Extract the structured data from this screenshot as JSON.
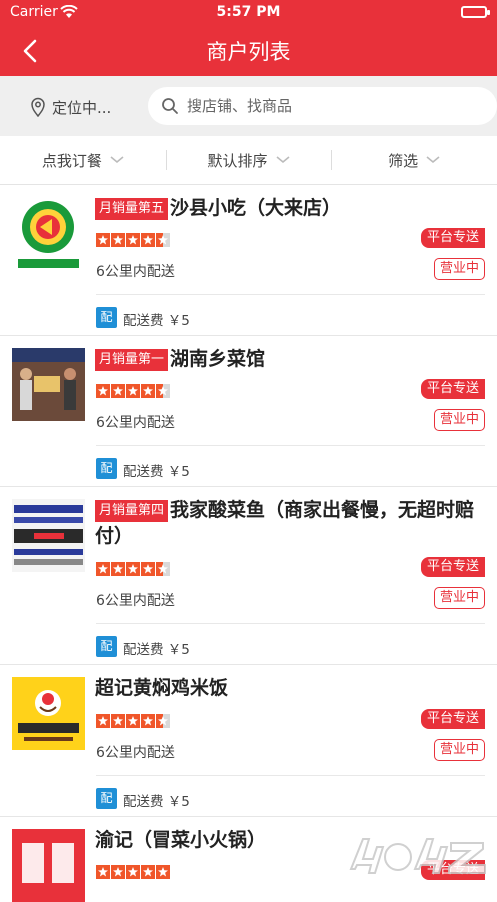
{
  "status_bar": {
    "carrier": "Carrier",
    "time": "5:57 PM"
  },
  "nav": {
    "title": "商户列表"
  },
  "search": {
    "location": "定位中...",
    "placeholder": "搜店铺、找商品"
  },
  "filters": [
    {
      "label": "点我订餐"
    },
    {
      "label": "默认排序"
    },
    {
      "label": "筛选"
    }
  ],
  "shops": [
    {
      "rank_badge": "月销量第五",
      "name": "沙县小吃（大来店）",
      "rating": 4.5,
      "delivery_range": "6公里内配送",
      "delivery_tag": "平台专送",
      "status": "营业中",
      "fee_icon": "配",
      "delivery_fee": "配送费 ￥5",
      "logo": "shaxian-logo"
    },
    {
      "rank_badge": "月销量第一",
      "name": "湖南乡菜馆",
      "rating": 4.5,
      "delivery_range": "6公里内配送",
      "delivery_tag": "平台专送",
      "status": "营业中",
      "fee_icon": "配",
      "delivery_fee": "配送费 ￥5",
      "logo": "hunan-photo"
    },
    {
      "rank_badge": "月销量第四",
      "name": "我家酸菜鱼（商家出餐慢，无超时赔付）",
      "rating": 4.5,
      "delivery_range": "6公里内配送",
      "delivery_tag": "平台专送",
      "status": "营业中",
      "fee_icon": "配",
      "delivery_fee": "配送费 ￥5",
      "logo": "fish-sign"
    },
    {
      "rank_badge": "",
      "name": "超记黄焖鸡米饭",
      "rating": 4.5,
      "delivery_range": "6公里内配送",
      "delivery_tag": "平台专送",
      "status": "营业中",
      "fee_icon": "配",
      "delivery_fee": "配送费 ￥5",
      "logo": "huangmenji-logo"
    },
    {
      "rank_badge": "",
      "name": "渝记（冒菜小火锅）",
      "rating": 5,
      "delivery_range": "",
      "delivery_tag": "平台专送",
      "status": "",
      "fee_icon": "",
      "delivery_fee": "",
      "logo": "yuji-logo"
    }
  ],
  "colors": {
    "brand": "#e8313a",
    "star": "#f0562a",
    "fee_icon": "#1f8fd6"
  }
}
